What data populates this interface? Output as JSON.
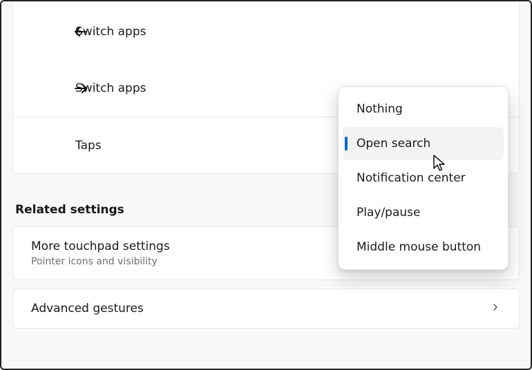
{
  "gestures": {
    "swipe_left_label": "Switch apps",
    "swipe_right_label": "Switch apps",
    "taps_label": "Taps"
  },
  "flyout": {
    "options": {
      "nothing": "Nothing",
      "open_search": "Open search",
      "notification_center": "Notification center",
      "play_pause": "Play/pause",
      "middle_mouse": "Middle mouse button"
    }
  },
  "related": {
    "heading": "Related settings",
    "more_touchpad": {
      "title": "More touchpad settings",
      "sub": "Pointer icons and visibility"
    },
    "advanced": {
      "title": "Advanced gestures"
    }
  }
}
